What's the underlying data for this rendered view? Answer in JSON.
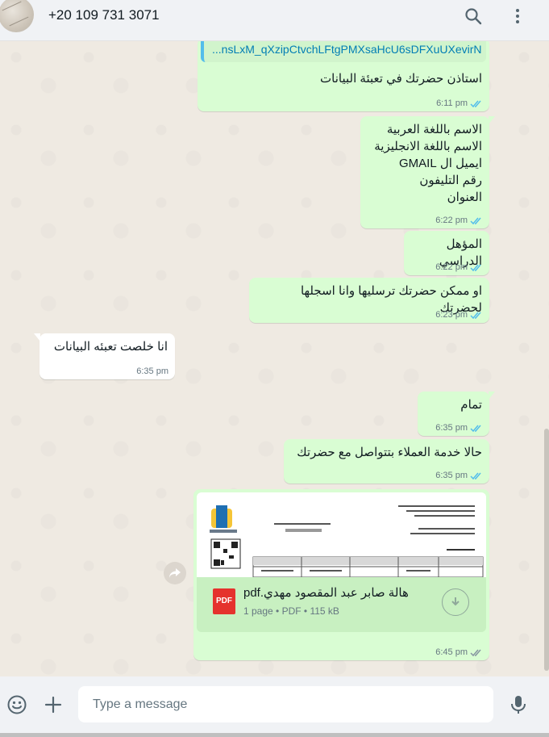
{
  "header": {
    "contact_name": "+20 109 731 3071",
    "icons": [
      "search-icon",
      "menu-icon"
    ]
  },
  "messages": [
    {
      "direction": "outgoing",
      "link_text": "...nsLxM_qXzipCtvchLFtgPMXsaHcU6sDFXuUXevirN",
      "text": "استاذن حضرتك في تعبئة البيانات",
      "time": "6:11 pm",
      "status": "read"
    },
    {
      "direction": "outgoing",
      "text": "الاسم باللغة العربية\nالاسم باللغة الانجليزية\nايميل ال GMAIL\nرقم التليفون\nالعنوان",
      "time": "6:22 pm",
      "status": "read"
    },
    {
      "direction": "outgoing",
      "text": "المؤهل الدراسي",
      "time": "6:22 pm",
      "status": "read"
    },
    {
      "direction": "outgoing",
      "text": "او ممكن حضرتك ترسليها وانا اسجلها لحضرتك",
      "time": "6:23 pm",
      "status": "read"
    },
    {
      "direction": "incoming",
      "text": "انا خلصت تعبئه البيانات",
      "time": "6:35 pm"
    },
    {
      "direction": "outgoing",
      "text": "تمام",
      "time": "6:35 pm",
      "status": "read"
    },
    {
      "direction": "outgoing",
      "text": "حالا خدمة العملاء بتتواصل مع حضرتك",
      "time": "6:35 pm",
      "status": "read"
    },
    {
      "direction": "outgoing",
      "type": "document",
      "file_name": "هالة صابر عبد المقصود مهدي.pdf",
      "file_icon": "PDF",
      "file_info": "1 page • PDF • 115 kB",
      "time": "6:45 pm",
      "status": "delivered"
    }
  ],
  "footer": {
    "placeholder": "Type a message",
    "icons": [
      "emoji-icon",
      "attach-plus-icon",
      "microphone-icon"
    ]
  },
  "colors": {
    "outgoing_bubble": "#d9fdd3",
    "incoming_bubble": "#ffffff",
    "read_ticks": "#53bdeb",
    "background": "#efeae2"
  }
}
